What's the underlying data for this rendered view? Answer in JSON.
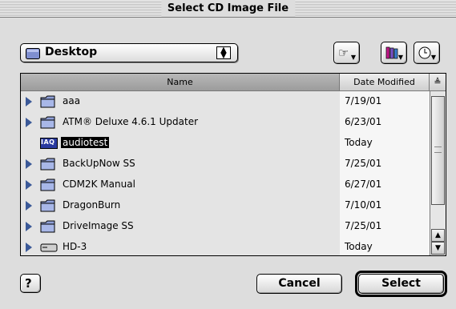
{
  "window": {
    "title": "Select CD Image File"
  },
  "location": {
    "current": "Desktop"
  },
  "toolbar": {
    "shortcuts_icon": "hand-pointer-icon",
    "favorites_icon": "books-icon",
    "recent_icon": "clock-icon"
  },
  "columns": {
    "name": "Name",
    "date": "Date Modified",
    "sort_indicator": "≜"
  },
  "files": [
    {
      "name": "aaa",
      "date": "7/19/01",
      "kind": "folder"
    },
    {
      "name": "ATM® Deluxe 4.6.1 Updater",
      "date": "6/23/01",
      "kind": "folder"
    },
    {
      "name": "audiotest",
      "date": "Today",
      "kind": "image",
      "selected": true
    },
    {
      "name": "BackUpNow SS",
      "date": "7/25/01",
      "kind": "folder"
    },
    {
      "name": "CDM2K Manual",
      "date": "6/27/01",
      "kind": "folder"
    },
    {
      "name": "DragonBurn",
      "date": "7/10/01",
      "kind": "folder"
    },
    {
      "name": "DriveImage SS",
      "date": "7/25/01",
      "kind": "folder"
    },
    {
      "name": "HD-3",
      "date": "Today",
      "kind": "disk"
    }
  ],
  "file_icon_label": "IAQ",
  "buttons": {
    "help": "?",
    "cancel": "Cancel",
    "select": "Select"
  },
  "colors": {
    "folder": "#8fa0d8",
    "selection": "#000000",
    "arrow": "#3b5998"
  }
}
